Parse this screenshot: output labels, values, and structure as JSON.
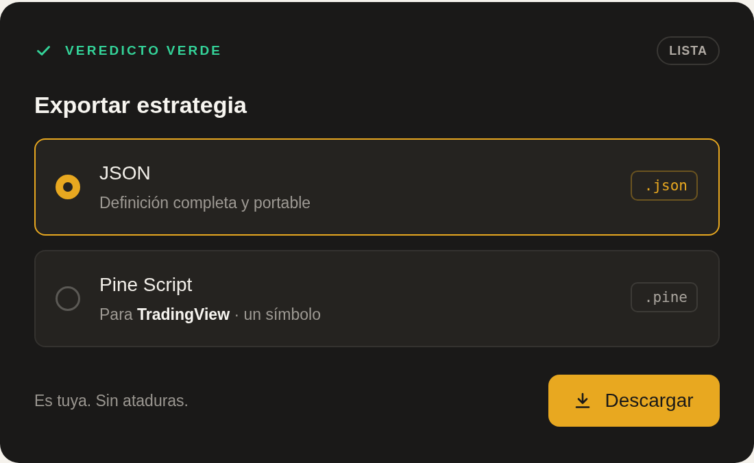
{
  "verdict": {
    "label": "VEREDICTO VERDE"
  },
  "status_badge": "LISTA",
  "title": "Exportar estrategia",
  "options": [
    {
      "title": "JSON",
      "description": "Definición completa y portable",
      "extension": ".json",
      "selected": true
    },
    {
      "title": "Pine Script",
      "description": "Para **TradingView** · un símbolo",
      "extension": ".pine",
      "selected": false
    }
  ],
  "footer": {
    "note": "Es tuya. Sin ataduras.",
    "button": "Descargar"
  }
}
